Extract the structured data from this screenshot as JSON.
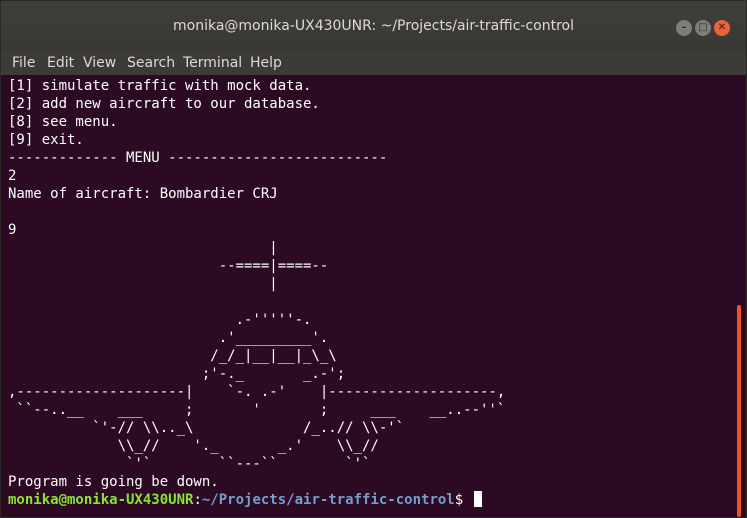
{
  "window": {
    "title": "monika@monika-UX430UNR: ~/Projects/air-traffic-control",
    "buttons": {
      "minimize": "–",
      "maximize": "□",
      "close": "✕"
    }
  },
  "menu": {
    "items": [
      "File",
      "Edit",
      "View",
      "Search",
      "Terminal",
      "Help"
    ]
  },
  "terminal": {
    "lines": [
      "[1] simulate traffic with mock data.",
      "[2] add new aircraft to our database.",
      "[8] see menu.",
      "[9] exit.",
      "------------- MENU --------------------------",
      "2",
      "Name of aircraft: Bombardier CRJ",
      "",
      "9",
      "                               |",
      "                         --====|====--",
      "                               |",
      "",
      "                           .-'''''-.",
      "                         .'_________'.",
      "                        /_/_|__|__|_\\_\\",
      "                       ;'-._       _.-';",
      ",--------------------|    `-. .-'    |--------------------,",
      " ``--..__    ___     ;       '       ;     ___    __..--''`",
      "          `'-// \\\\.._\\             /_..// \\\\-'`",
      "             \\\\_//    '._       _.'    \\\\_//",
      "              `'`        ``---``        `'`",
      "Program is going be down."
    ],
    "prompt": {
      "user_host": "monika@monika-UX430UNR",
      "separator": ":",
      "path": "~/Projects/air-traffic-control",
      "symbol": "$ "
    }
  },
  "colors": {
    "background": "#2c0a24",
    "prompt_user": "#8ae234",
    "prompt_path": "#729fcf",
    "scrollbar": "#e95420"
  }
}
